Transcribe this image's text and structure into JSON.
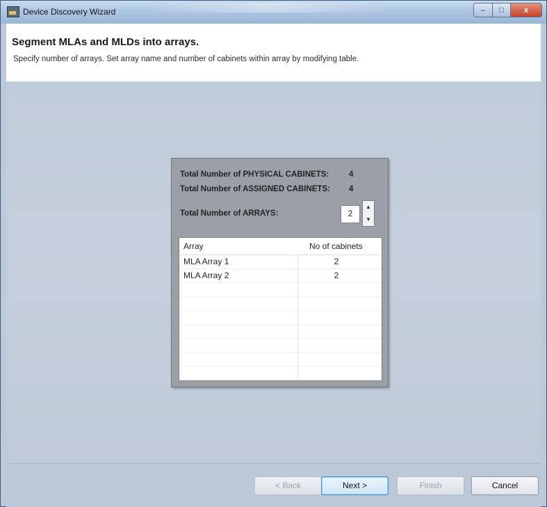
{
  "window": {
    "title": "Device Discovery Wizard",
    "controls": {
      "minimize": "–",
      "maximize": "□",
      "close": "x"
    }
  },
  "header": {
    "title": "Segment MLAs and MLDs into arrays.",
    "subtitle": "Specify number of arrays. Set array name and number of cabinets within array by modifying table."
  },
  "panel": {
    "physical_label": "Total Number of PHYSICAL CABINETS:",
    "physical_value": "4",
    "assigned_label": "Total Number of ASSIGNED CABINETS:",
    "assigned_value": "4",
    "arrays_label": "Total Number of ARRAYS:",
    "arrays_value": "2",
    "spin_up": "▲",
    "spin_down": "▼"
  },
  "table": {
    "columns": [
      "Array",
      "No of cabinets"
    ],
    "rows": [
      {
        "array": "MLA Array 1",
        "cabinets": "2"
      },
      {
        "array": "MLA Array 2",
        "cabinets": "2"
      },
      {
        "array": "",
        "cabinets": ""
      },
      {
        "array": "",
        "cabinets": ""
      },
      {
        "array": "",
        "cabinets": ""
      },
      {
        "array": "",
        "cabinets": ""
      },
      {
        "array": "",
        "cabinets": ""
      },
      {
        "array": "",
        "cabinets": ""
      },
      {
        "array": "",
        "cabinets": ""
      }
    ]
  },
  "footer": {
    "back_label": "< Back",
    "next_label": "Next >",
    "finish_label": "Finish",
    "cancel_label": "Cancel"
  },
  "colors": {
    "title_gradient_top": "#c9dbee",
    "content_bg": "#c5cfdc",
    "panel_bg": "#9aa0a6",
    "primary_button_border": "#3d8fd1",
    "close_button": "#c6442c"
  },
  "icons": {
    "app": "device-discovery-icon",
    "minimize": "minimize-icon",
    "maximize": "maximize-icon",
    "close": "close-icon",
    "spin_up": "spin-up-arrow-icon",
    "spin_down": "spin-down-arrow-icon"
  }
}
